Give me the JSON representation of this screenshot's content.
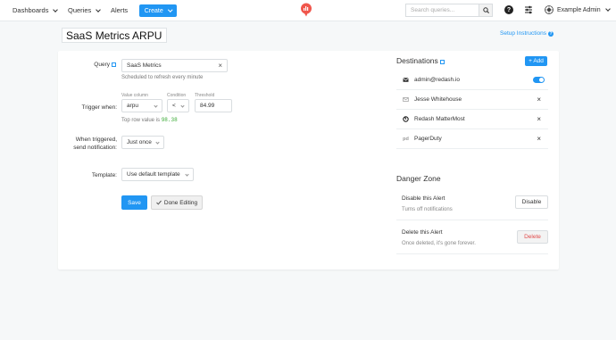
{
  "header": {
    "nav": [
      {
        "label": "Dashboards"
      },
      {
        "label": "Queries"
      },
      {
        "label": "Alerts"
      }
    ],
    "create_label": "Create",
    "search_placeholder": "Search queries...",
    "user_name": "Example Admin"
  },
  "page": {
    "title": "SaaS Metrics ARPU",
    "setup_link": "Setup Instructions"
  },
  "form": {
    "query_label": "Query",
    "query_value": "SaaS Metrics",
    "query_hint": "Scheduled to refresh every minute",
    "trigger_label": "Trigger when:",
    "value_column_caption": "Value column",
    "value_column": "arpu",
    "condition_caption": "Condition",
    "condition": "<",
    "threshold_caption": "Threshold",
    "threshold": "84.99",
    "top_row_prefix": "Top row value is",
    "top_row_value": "98.38",
    "notify_label_line1": "When triggered,",
    "notify_label_line2": "send notification:",
    "notify_value": "Just once",
    "template_label": "Template:",
    "template_value": "Use default template",
    "save_label": "Save",
    "done_label": "Done Editing"
  },
  "destinations": {
    "title": "Destinations",
    "add_label": "+ Add",
    "items": [
      {
        "name": "admin@redash.io",
        "icon": "envelope-icon",
        "enabled": true
      },
      {
        "name": "Jesse Whitehouse",
        "icon": "envelope-outline-icon"
      },
      {
        "name": "Redash MatterMost",
        "icon": "mattermost-icon"
      },
      {
        "name": "PagerDuty",
        "icon": "pagerduty-icon"
      }
    ]
  },
  "danger_zone": {
    "title": "Danger Zone",
    "disable_title": "Disable this Alert",
    "disable_sub": "Turns off notifications",
    "disable_btn": "Disable",
    "delete_title": "Delete this Alert",
    "delete_sub": "Once deleted, it's gone forever.",
    "delete_btn": "Delete"
  },
  "colors": {
    "primary": "#2196f3",
    "danger": "#e04a4a",
    "logo": "#f0564c",
    "mono_value": "#3aaa35"
  }
}
